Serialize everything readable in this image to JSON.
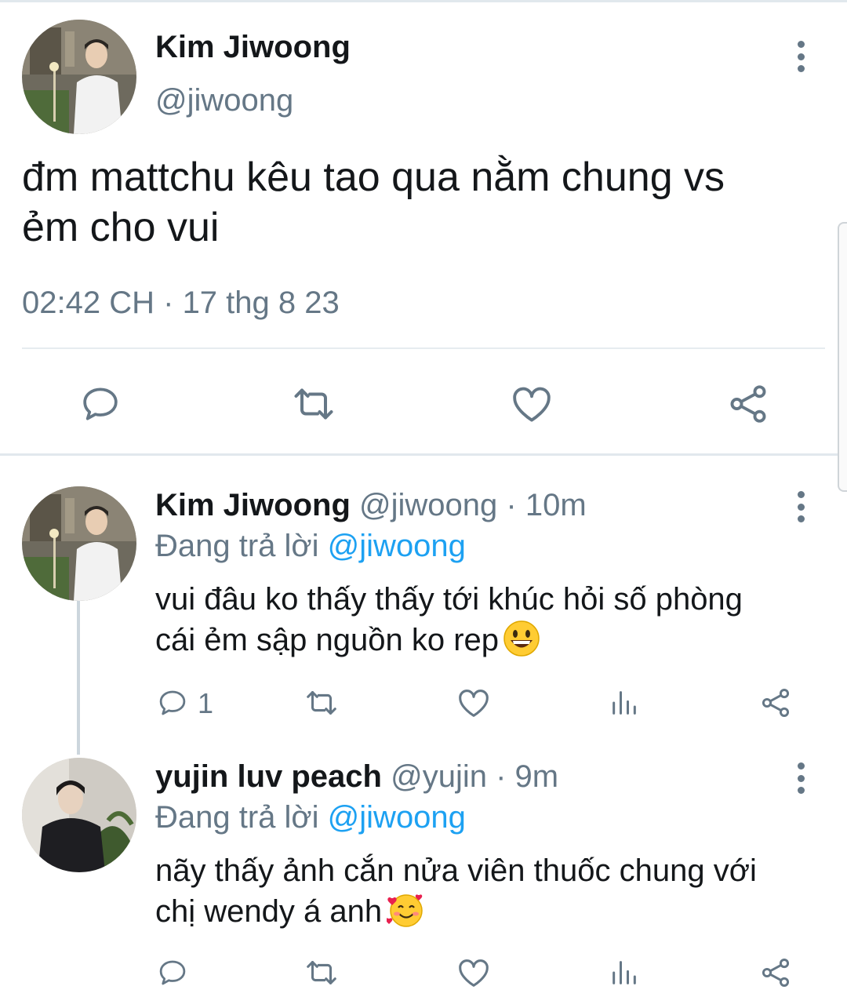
{
  "main_tweet": {
    "display_name": "Kim Jiwoong",
    "handle": "@jiwoong",
    "text_line1": "đm mattchu kêu tao qua nằm chung vs",
    "text_line2": "ẻm cho vui",
    "time": "02:42 CH",
    "separator": "·",
    "date": "17 thg 8 23",
    "actions": [
      "reply-icon",
      "retweet-icon",
      "like-icon",
      "share-icon"
    ]
  },
  "replies": [
    {
      "display_name": "Kim Jiwoong",
      "handle": "@jiwoong",
      "dot": "·",
      "age": "10m",
      "replying_prefix": "Đang trả lời",
      "replying_to": "@jiwoong",
      "text_line1": "vui đâu ko thấy thấy tới khúc hỏi số phòng",
      "text_line2": "cái ẻm sập nguồn ko rep",
      "emoji": "grinning-face",
      "reply_count": "1"
    },
    {
      "display_name": "yujin luv peach",
      "handle": "@yujin",
      "dot": "·",
      "age": "9m",
      "replying_prefix": "Đang trả lời",
      "replying_to": "@jiwoong",
      "text_line1": "nãy thấy ảnh cắn nửa viên thuốc chung với",
      "text_line2": "chị wendy á anh",
      "emoji": "smiling-face-with-hearts",
      "reply_count": ""
    }
  ],
  "colors": {
    "text": "#14171a",
    "secondary": "#657786",
    "link": "#1da1f2",
    "divider": "#e6ecf0"
  }
}
